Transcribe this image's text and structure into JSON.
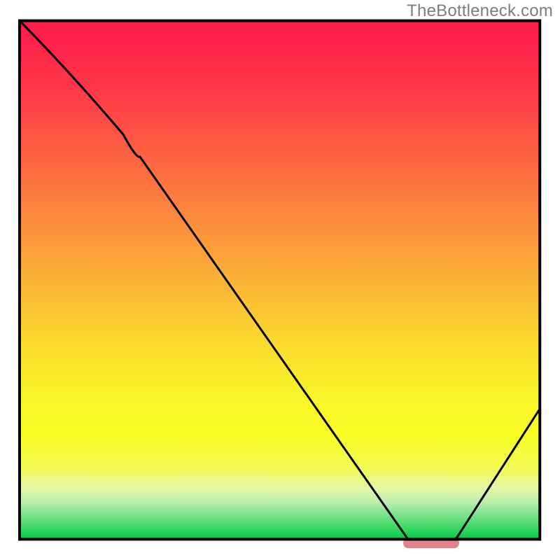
{
  "watermark": "TheBottleneck.com",
  "chart_data": {
    "type": "line",
    "title": "",
    "xlabel": "",
    "ylabel": "",
    "x_range": [
      0,
      100
    ],
    "y_range": [
      0,
      100
    ],
    "curve": [
      {
        "x": 3.5,
        "y": 96.3
      },
      {
        "x": 22.0,
        "y": 76.0
      },
      {
        "x": 25.0,
        "y": 72.0
      },
      {
        "x": 73.0,
        "y": 3.5
      },
      {
        "x": 74.0,
        "y": 3.3
      },
      {
        "x": 80.0,
        "y": 3.3
      },
      {
        "x": 81.0,
        "y": 3.5
      },
      {
        "x": 96.4,
        "y": 27.0
      }
    ],
    "soft_marker": {
      "x_start": 72,
      "x_end": 82,
      "y": 3.0
    },
    "gradient_stops": [
      {
        "offset": 0.0,
        "color": "#fe1a4b"
      },
      {
        "offset": 0.12,
        "color": "#fe3448"
      },
      {
        "offset": 0.25,
        "color": "#fd5f43"
      },
      {
        "offset": 0.38,
        "color": "#fc8a3d"
      },
      {
        "offset": 0.5,
        "color": "#fbb236"
      },
      {
        "offset": 0.62,
        "color": "#fada2e"
      },
      {
        "offset": 0.73,
        "color": "#f9f627"
      },
      {
        "offset": 0.8,
        "color": "#f9fd25"
      },
      {
        "offset": 0.86,
        "color": "#f5fc52"
      },
      {
        "offset": 0.9,
        "color": "#e5f8a4"
      },
      {
        "offset": 0.93,
        "color": "#b7eead"
      },
      {
        "offset": 0.96,
        "color": "#69df80"
      },
      {
        "offset": 1.0,
        "color": "#00cd44"
      }
    ],
    "green_band": {
      "y_start": 4.5,
      "y_end": 0
    },
    "frame": {
      "x": 3.5,
      "y": 3.7,
      "w": 92.9,
      "h": 92.6
    }
  }
}
